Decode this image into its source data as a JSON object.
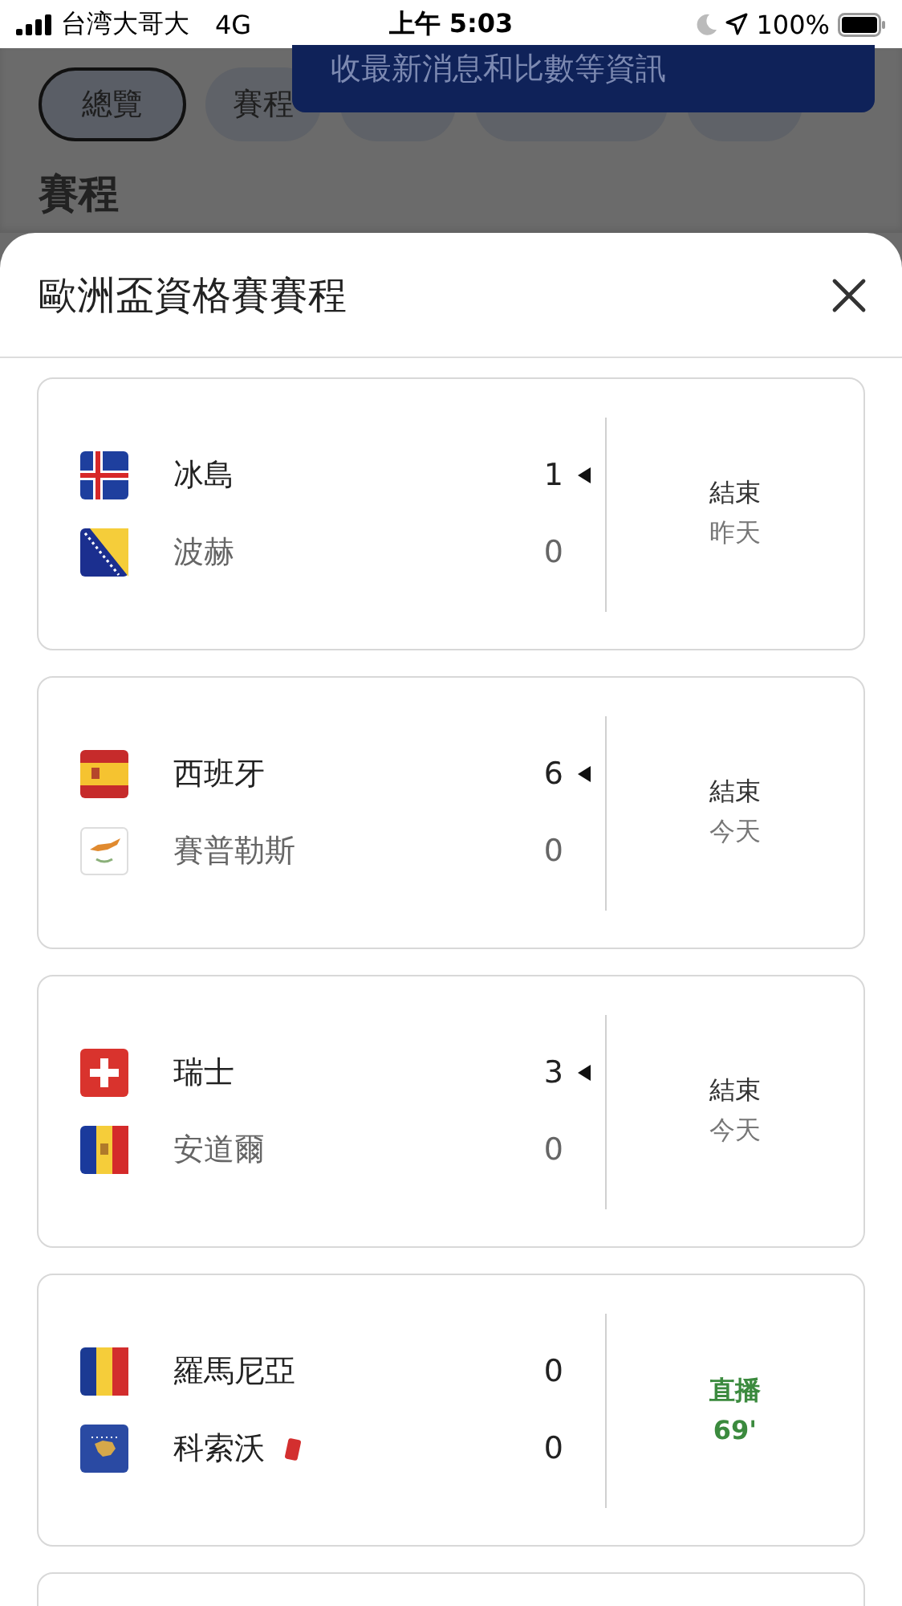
{
  "status_bar": {
    "carrier": "台湾大哥大",
    "network": "4G",
    "time": "上午 5:03",
    "battery": "100%"
  },
  "background": {
    "tabs": [
      {
        "label": "總覽",
        "selected": true
      },
      {
        "label": "賽程",
        "selected": false
      },
      {
        "selected": false
      },
      {
        "selected": false
      },
      {
        "selected": false
      }
    ],
    "section_title": "賽程",
    "banner": "收最新消息和比數等資訊"
  },
  "sheet": {
    "title": "歐洲盃資格賽賽程",
    "matches": [
      {
        "kind": "final",
        "teams": [
          {
            "name": "冰島",
            "score": "1",
            "winner": true,
            "red_card": false
          },
          {
            "name": "波赫",
            "score": "0",
            "winner": false,
            "red_card": false
          }
        ],
        "status": "結束",
        "detail": "昨天"
      },
      {
        "kind": "final",
        "teams": [
          {
            "name": "西班牙",
            "score": "6",
            "winner": true,
            "red_card": false
          },
          {
            "name": "賽普勒斯",
            "score": "0",
            "winner": false,
            "red_card": false
          }
        ],
        "status": "結束",
        "detail": "今天"
      },
      {
        "kind": "final",
        "teams": [
          {
            "name": "瑞士",
            "score": "3",
            "winner": true,
            "red_card": false
          },
          {
            "name": "安道爾",
            "score": "0",
            "winner": false,
            "red_card": false
          }
        ],
        "status": "結束",
        "detail": "今天"
      },
      {
        "kind": "live",
        "teams": [
          {
            "name": "羅馬尼亞",
            "score": "0",
            "winner": false,
            "red_card": false
          },
          {
            "name": "科索沃",
            "score": "0",
            "winner": false,
            "red_card": true
          }
        ],
        "status": "直播",
        "detail": "69'"
      }
    ]
  }
}
